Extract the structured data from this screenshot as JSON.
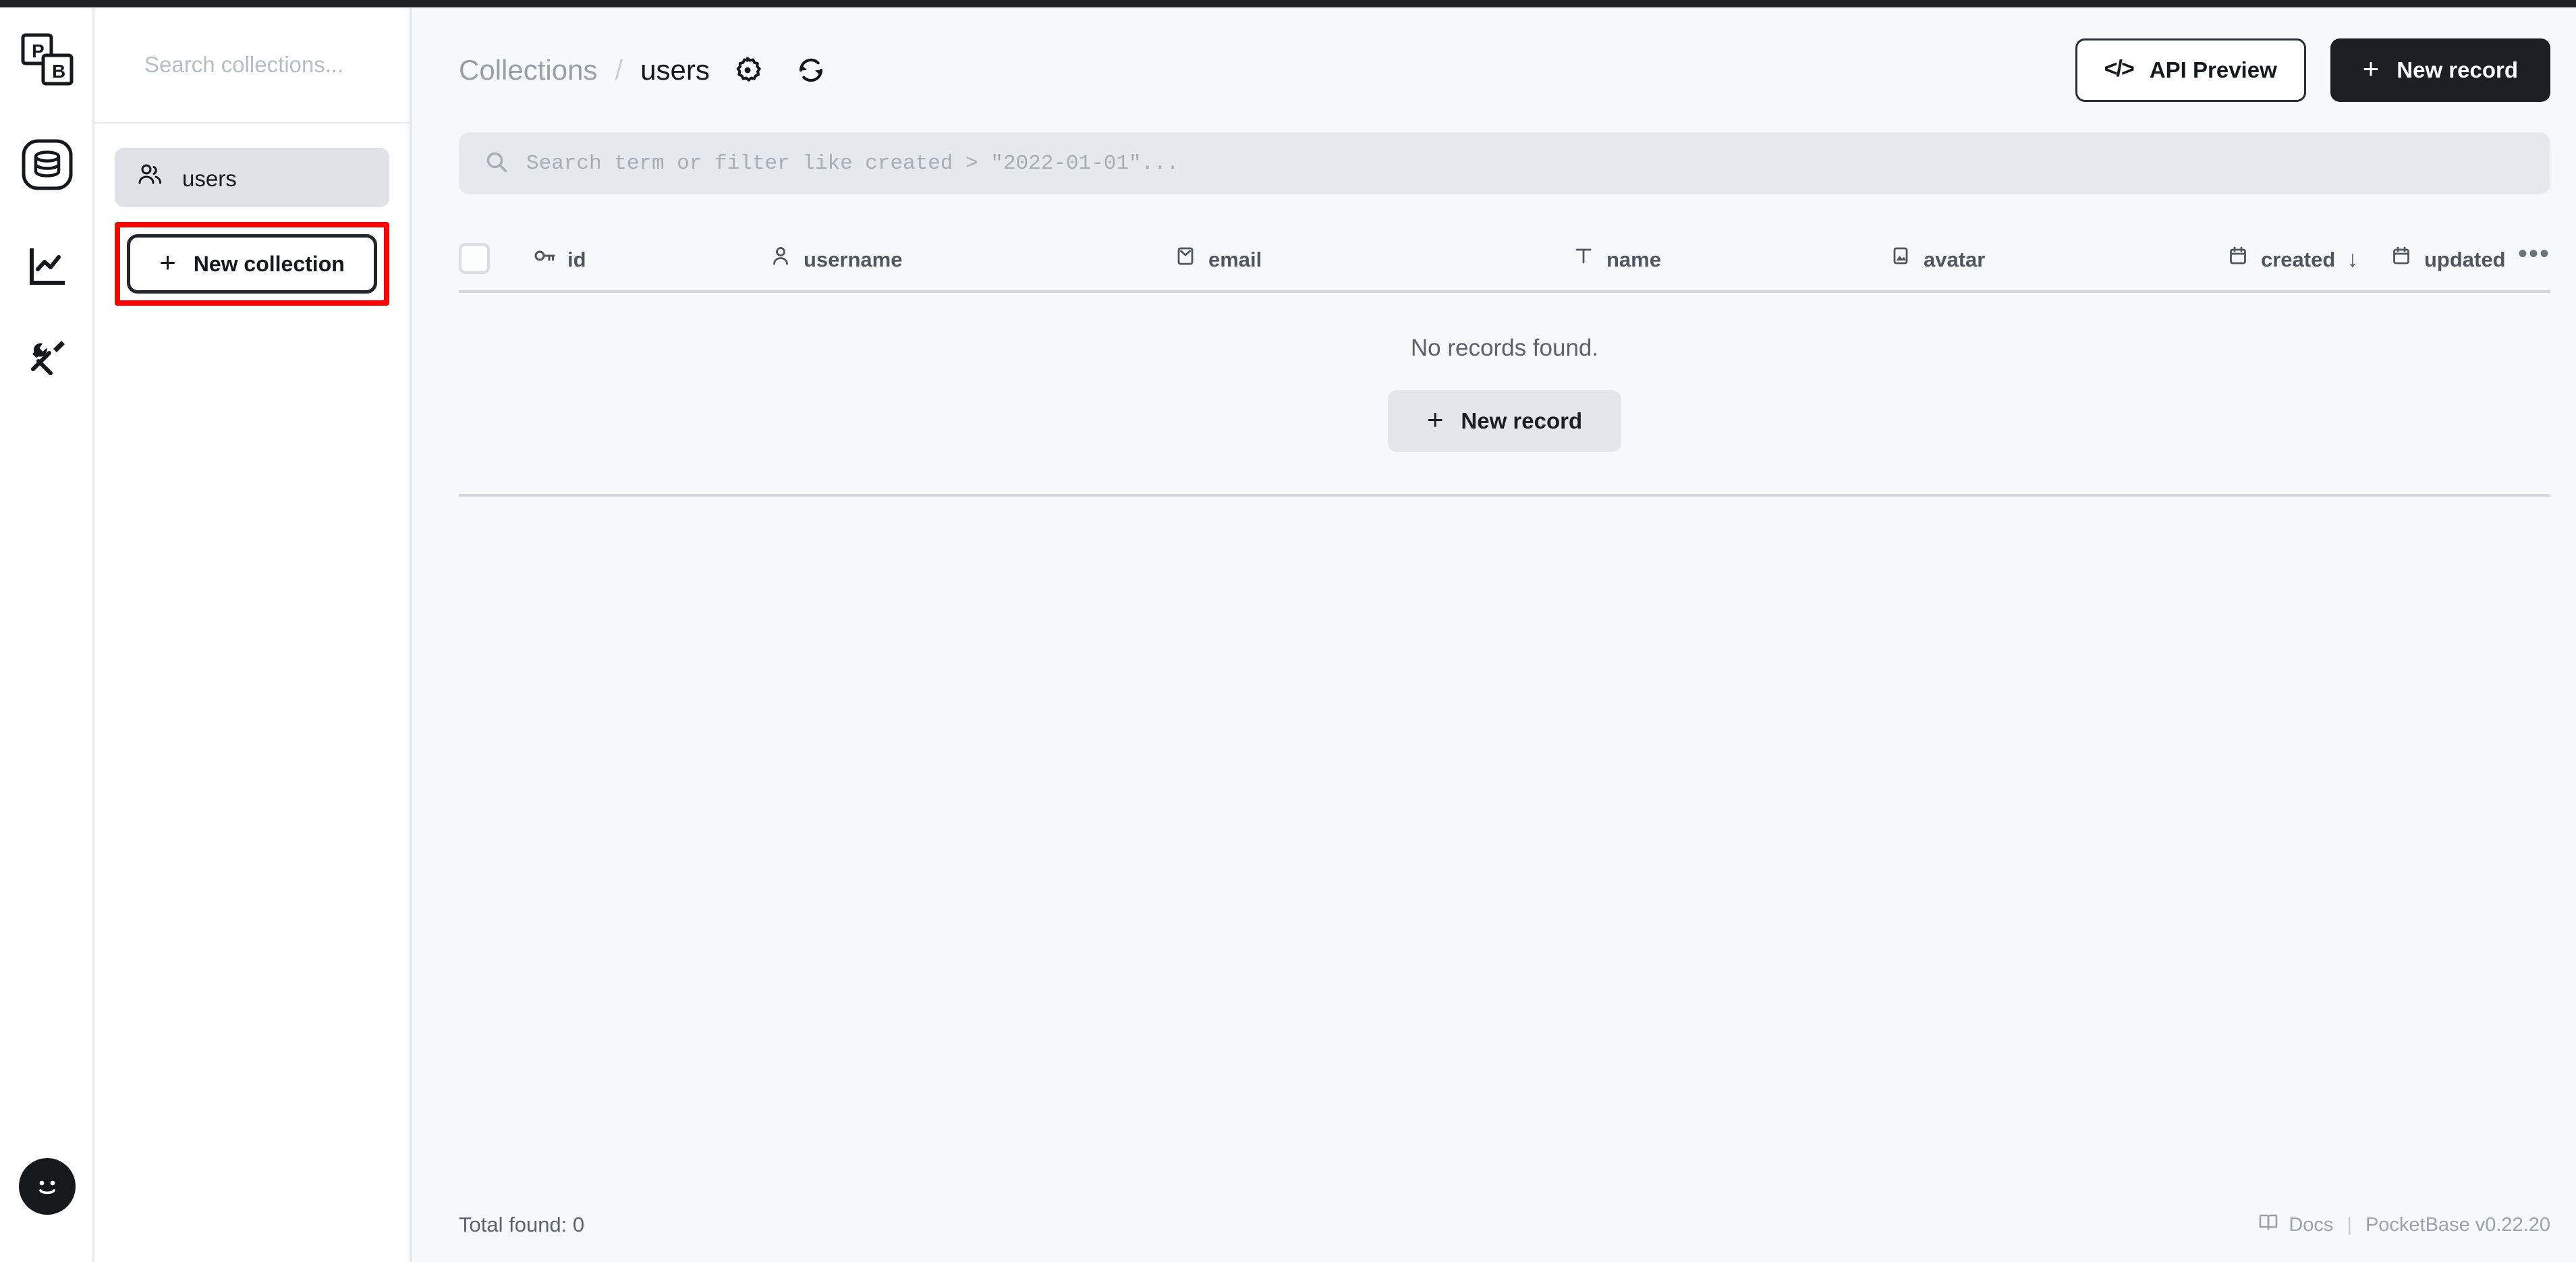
{
  "app": {
    "brand": "PocketBase",
    "logo_letters": [
      "P",
      "B"
    ]
  },
  "rail": {
    "items": [
      {
        "name": "collections",
        "icon": "database-icon",
        "active": true
      },
      {
        "name": "logs",
        "icon": "chart-line-icon",
        "active": false
      },
      {
        "name": "settings",
        "icon": "tools-icon",
        "active": false
      }
    ],
    "avatar": {
      "icon": "smiley-avatar-icon"
    }
  },
  "collections_panel": {
    "search": {
      "placeholder": "Search collections...",
      "value": ""
    },
    "items": [
      {
        "label": "users",
        "icon": "users-icon",
        "selected": true
      }
    ],
    "new_collection_label": "New collection",
    "plus": "+",
    "highlight_color": "#ff0000"
  },
  "header": {
    "breadcrumb": {
      "root": "Collections",
      "separator": "/",
      "current": "users"
    },
    "icons": [
      {
        "name": "gear-icon",
        "label": "Collection settings"
      },
      {
        "name": "refresh-icon",
        "label": "Refresh"
      }
    ],
    "api_preview_label": "API Preview",
    "api_preview_glyph": "</>",
    "new_record_label": "New record",
    "plus": "+"
  },
  "filter": {
    "placeholder": "Search term or filter like created > \"2022-01-01\"...",
    "value": "",
    "icon": "search-icon"
  },
  "table": {
    "select_all_checked": false,
    "columns": [
      {
        "label": "id",
        "icon": "key-icon",
        "sorted": null
      },
      {
        "label": "username",
        "icon": "user-icon",
        "sorted": null
      },
      {
        "label": "email",
        "icon": "envelope-icon",
        "sorted": null
      },
      {
        "label": "name",
        "icon": "text-icon",
        "sorted": null
      },
      {
        "label": "avatar",
        "icon": "image-icon",
        "sorted": null
      },
      {
        "label": "created",
        "icon": "calendar-icon",
        "sorted": "desc"
      },
      {
        "label": "updated",
        "icon": "calendar-icon",
        "sorted": null
      }
    ],
    "sort_desc_glyph": "↓",
    "more_glyph": "•••",
    "empty_message": "No records found.",
    "empty_new_record_label": "New record",
    "rows": []
  },
  "footer": {
    "total_found_label": "Total found:",
    "total_found_value": "0",
    "docs_label": "Docs",
    "docs_icon": "book-icon",
    "separator": "|",
    "version_label": "PocketBase v0.22.20"
  }
}
